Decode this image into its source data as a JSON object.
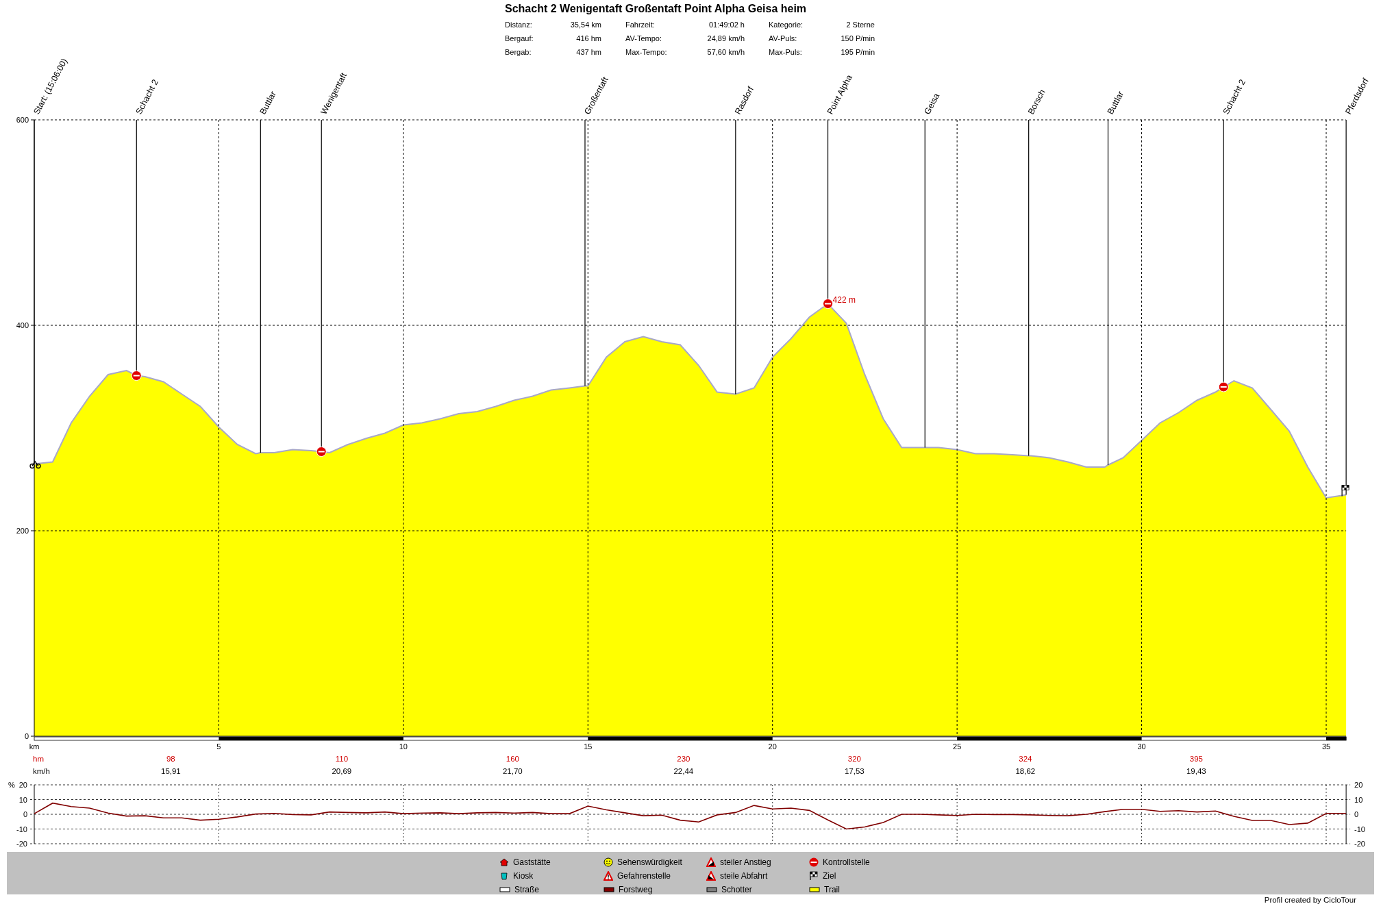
{
  "title": "Schacht 2 Wenigentaft Großentaft Point Alpha Geisa heim",
  "stats": [
    {
      "label": "Distanz:",
      "value": "35,54 km"
    },
    {
      "label": "Fahrzeit:",
      "value": "01:49:02 h"
    },
    {
      "label": "Kategorie:",
      "value": "2 Sterne"
    },
    {
      "label": "Bergauf:",
      "value": "416 hm"
    },
    {
      "label": "AV-Tempo:",
      "value": "24,89 km/h"
    },
    {
      "label": "AV-Puls:",
      "value": "150 P/min"
    },
    {
      "label": "Bergab:",
      "value": "437 hm"
    },
    {
      "label": "Max-Tempo:",
      "value": "57,60 km/h"
    },
    {
      "label": "Max-Puls:",
      "value": "195 P/min"
    }
  ],
  "profile": {
    "chart_data": {
      "type": "area",
      "grid": true,
      "xlabel": "km",
      "xlim": [
        0,
        35.54
      ],
      "ylim": [
        0,
        600
      ],
      "xticks": [
        5,
        10,
        15,
        20,
        25,
        30,
        35
      ],
      "yticks": [
        0,
        200,
        400,
        600
      ],
      "x": [
        0,
        0.5,
        1,
        1.5,
        2,
        2.5,
        2.77,
        3,
        3.5,
        4,
        4.5,
        5,
        5.5,
        6,
        6.13,
        6.5,
        7,
        7.5,
        7.78,
        8,
        8.5,
        9,
        9.5,
        10,
        10.5,
        11,
        11.5,
        12,
        12.5,
        13,
        13.5,
        14,
        14.5,
        14.92,
        15,
        15.5,
        16,
        16.5,
        17,
        17.5,
        18,
        18.5,
        19,
        19.5,
        20,
        20.5,
        21,
        21.5,
        22,
        22.5,
        23,
        23.5,
        24,
        24.13,
        24.5,
        25,
        25.5,
        26,
        26.5,
        26.94,
        27,
        27.5,
        28,
        28.5,
        29,
        29.09,
        29.5,
        30,
        30.5,
        31,
        31.5,
        32,
        32.22,
        32.5,
        33,
        33.5,
        34,
        34.5,
        35,
        35.54
      ],
      "series": [
        {
          "color": "#ffff00",
          "values": [
            265,
            267,
            305,
            331,
            352,
            356,
            351,
            350,
            345,
            333,
            321,
            301,
            284,
            275,
            276,
            276,
            279,
            278,
            277,
            276,
            284,
            290,
            295,
            303,
            305,
            309,
            314,
            316,
            321,
            327,
            331,
            337,
            339,
            341,
            341,
            369,
            384,
            389,
            384,
            381,
            361,
            335,
            333,
            339,
            369,
            387,
            408,
            421,
            402,
            352,
            309,
            281,
            281,
            281,
            281,
            279,
            275,
            275,
            274,
            273,
            273,
            271,
            267,
            262,
            262,
            264,
            271,
            288,
            305,
            315,
            327,
            335,
            340,
            346,
            339,
            318,
            297,
            262,
            232,
            235
          ]
        }
      ],
      "annotations": [
        {
          "x": 0,
          "y": 265,
          "text": "Start: (15:06:00)"
        },
        {
          "x": 2.77,
          "y": 351,
          "text": "Schacht 2"
        },
        {
          "x": 6.13,
          "y": 276,
          "text": "Buttlar"
        },
        {
          "x": 7.78,
          "y": 277,
          "text": "Wenigentaft"
        },
        {
          "x": 14.92,
          "y": 341,
          "text": "Großentaft"
        },
        {
          "x": 19,
          "y": 333,
          "text": "Rasdorf"
        },
        {
          "x": 21.5,
          "y": 421,
          "text": "Point Alpha"
        },
        {
          "x": 24.13,
          "y": 281,
          "text": "Geisa"
        },
        {
          "x": 26.94,
          "y": 273,
          "text": "Borsch"
        },
        {
          "x": 29.09,
          "y": 264,
          "text": "Buttlar"
        },
        {
          "x": 32.22,
          "y": 340,
          "text": "Schacht 2"
        },
        {
          "x": 21.5,
          "y": 421,
          "text": "422 m"
        }
      ]
    },
    "waypoints": [
      {
        "kind": "start"
      },
      {
        "kind": "stop"
      },
      {
        "kind": "waypoint"
      },
      {
        "kind": "stop"
      },
      {
        "kind": "waypoint"
      },
      {
        "kind": "waypoint"
      },
      {
        "kind": "stop"
      },
      {
        "kind": "waypoint"
      },
      {
        "kind": "waypoint"
      },
      {
        "kind": "waypoint"
      },
      {
        "kind": "stop"
      }
    ],
    "end_label": "Pferdsdorf",
    "row_labels": {
      "climb": "hm",
      "speed": "km/h"
    },
    "segments": [
      {
        "climb": "98",
        "speed": "15,91"
      },
      {
        "climb": "110",
        "speed": "20,69"
      },
      {
        "climb": "160",
        "speed": "21,70"
      },
      {
        "climb": "230",
        "speed": "22,44"
      },
      {
        "climb": "320",
        "speed": "17,53"
      },
      {
        "climb": "324",
        "speed": "18,62"
      },
      {
        "climb": "395",
        "speed": "19,43"
      }
    ]
  },
  "gradient": {
    "right_axis_labels": [
      "20",
      "10",
      "0",
      "-10",
      "-20"
    ],
    "chart_data": {
      "type": "line",
      "grid": true,
      "ylabel": "%",
      "xlim": [
        0,
        35.54
      ],
      "ylim": [
        -20,
        20
      ],
      "yticks": [
        -20,
        -10,
        0,
        10,
        20
      ],
      "x": [
        0,
        0.5,
        1,
        1.5,
        2,
        2.5,
        3,
        3.5,
        4,
        4.5,
        5,
        5.5,
        6,
        6.5,
        7,
        7.5,
        8,
        8.5,
        9,
        9.5,
        10,
        10.5,
        11,
        11.5,
        12,
        12.5,
        13,
        13.5,
        14,
        14.5,
        15,
        15.5,
        16,
        16.5,
        17,
        17.5,
        18,
        18.5,
        19,
        19.5,
        20,
        20.5,
        21,
        21.5,
        22,
        22.5,
        23,
        23.5,
        24,
        24.5,
        25,
        25.5,
        26,
        26.5,
        27,
        27.5,
        28,
        28.5,
        29,
        29.5,
        30,
        30.5,
        31,
        31.5,
        32,
        32.5,
        33,
        33.5,
        34,
        34.5,
        35,
        35.54
      ],
      "series": [
        {
          "color": "#800000",
          "values": [
            0.4,
            7.6,
            5.2,
            4.2,
            0.8,
            -1.2,
            -1,
            -2.4,
            -2.4,
            -4,
            -3.4,
            -1.8,
            0.2,
            0.6,
            -0.2,
            -0.4,
            1.6,
            1.2,
            1,
            1.6,
            0.4,
            0.8,
            1,
            0.4,
            1,
            1.2,
            0.8,
            1.2,
            0.4,
            0.4,
            5.6,
            3,
            1,
            -1,
            -0.6,
            -4,
            -5.2,
            -0.4,
            1.2,
            6,
            3.6,
            4.2,
            2.6,
            -3.8,
            -10,
            -8.6,
            -5.6,
            0,
            0,
            -0.4,
            -0.8,
            0,
            -0.2,
            -0.2,
            -0.4,
            -0.8,
            -1,
            0,
            1.8,
            3.4,
            3.4,
            2,
            2.4,
            1.6,
            2.2,
            -1.4,
            -4.2,
            -4.2,
            -7,
            -6,
            0.6,
            0.6
          ]
        }
      ]
    }
  },
  "legend": [
    {
      "label": "Gaststätte",
      "kind": "inn"
    },
    {
      "label": "Sehenswürdigkeit",
      "kind": "sight"
    },
    {
      "label": "steiler Anstieg",
      "kind": "climb"
    },
    {
      "label": "Kontrollstelle",
      "kind": "stop"
    },
    {
      "label": "Kiosk",
      "kind": "kiosk"
    },
    {
      "label": "Gefahrenstelle",
      "kind": "danger"
    },
    {
      "label": "steile Abfahrt",
      "kind": "descent"
    },
    {
      "label": "Ziel",
      "kind": "finish"
    },
    {
      "label": "Straße",
      "kind": "road"
    },
    {
      "label": "Forstweg",
      "kind": "forest"
    },
    {
      "label": "Schotter",
      "kind": "gravel"
    },
    {
      "label": "Trail",
      "kind": "trail"
    }
  ],
  "credit": "Profil created by CicloTour"
}
